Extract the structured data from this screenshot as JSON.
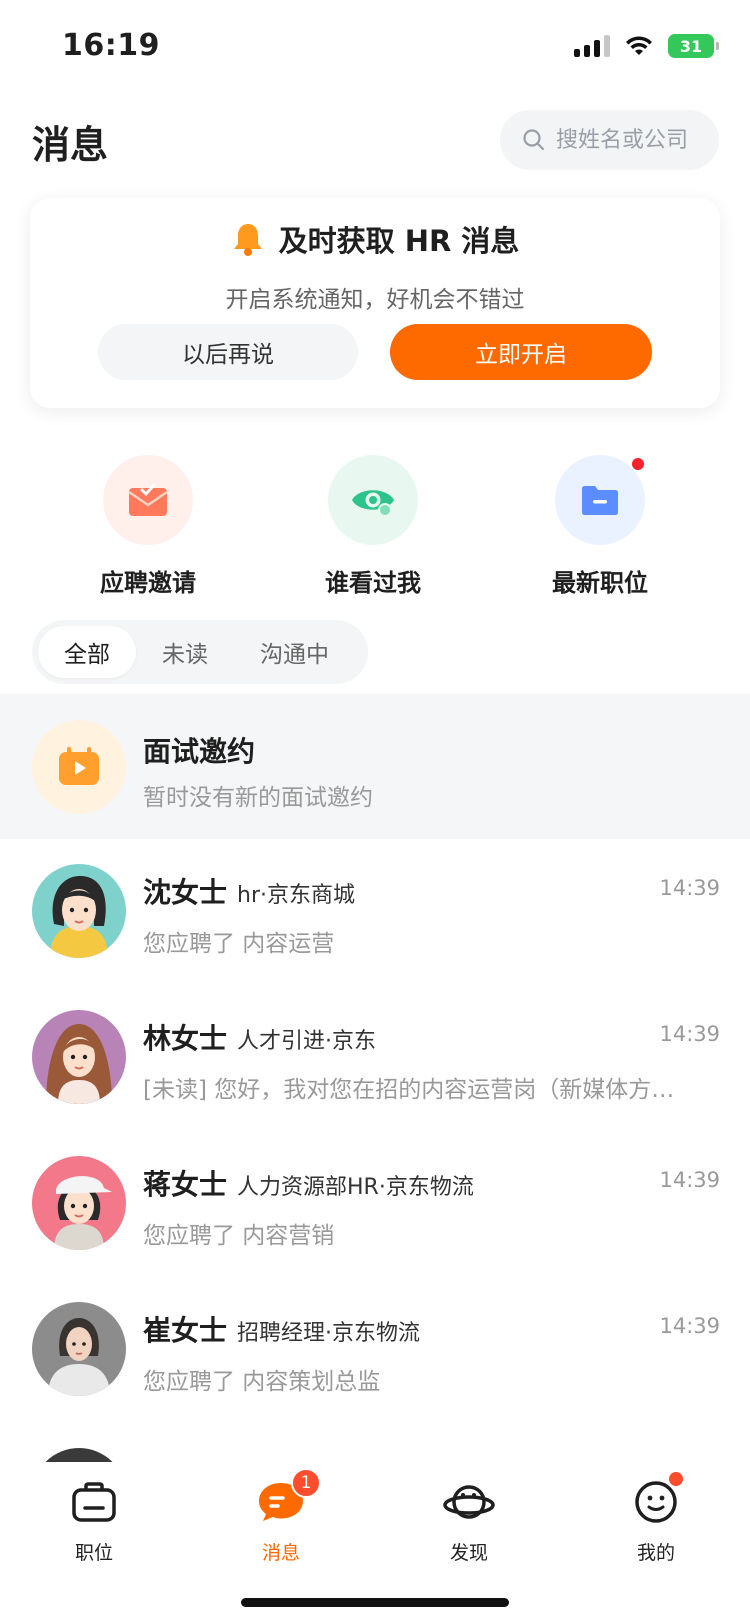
{
  "status_bar": {
    "time": "16:19",
    "battery": "31"
  },
  "header": {
    "title": "消息",
    "search_placeholder": "搜姓名或公司"
  },
  "notify_card": {
    "title": "及时获取 HR 消息",
    "subtitle": "开启系统通知，好机会不错过",
    "later_label": "以后再说",
    "open_label": "立即开启"
  },
  "quick_entries": [
    {
      "label": "应聘邀请",
      "icon": "envelope-icon",
      "has_dot": false
    },
    {
      "label": "谁看过我",
      "icon": "eye-icon",
      "has_dot": false
    },
    {
      "label": "最新职位",
      "icon": "folder-icon",
      "has_dot": true
    }
  ],
  "filters": {
    "items": [
      "全部",
      "未读",
      "沟通中"
    ],
    "active": "全部"
  },
  "interview": {
    "title": "面试邀约",
    "subtitle": "暂时没有新的面试邀约"
  },
  "chats": [
    {
      "name": "沈女士",
      "meta": "hr·京东商城",
      "time": "14:39",
      "message": "您应聘了 内容运营"
    },
    {
      "name": "林女士",
      "meta": "人才引进·京东",
      "time": "14:39",
      "message": "[未读] 您好，我对您在招的内容运营岗（新媒体方向）很感兴趣"
    },
    {
      "name": "蒋女士",
      "meta": "人力资源部HR·京东物流",
      "time": "14:39",
      "message": "您应聘了 内容营销"
    },
    {
      "name": "崔女士",
      "meta": "招聘经理·京东物流",
      "time": "14:39",
      "message": "您应聘了 内容策划总监"
    }
  ],
  "tab_bar": {
    "items": [
      {
        "label": "职位",
        "icon": "briefcase-icon"
      },
      {
        "label": "消息",
        "icon": "chat-bubble-icon",
        "badge": "1"
      },
      {
        "label": "发现",
        "icon": "planet-icon"
      },
      {
        "label": "我的",
        "icon": "smiley-icon"
      }
    ],
    "active": "消息"
  },
  "colors": {
    "accent": "#ff6a00",
    "badge": "#ff4d2e",
    "muted": "#999999"
  }
}
